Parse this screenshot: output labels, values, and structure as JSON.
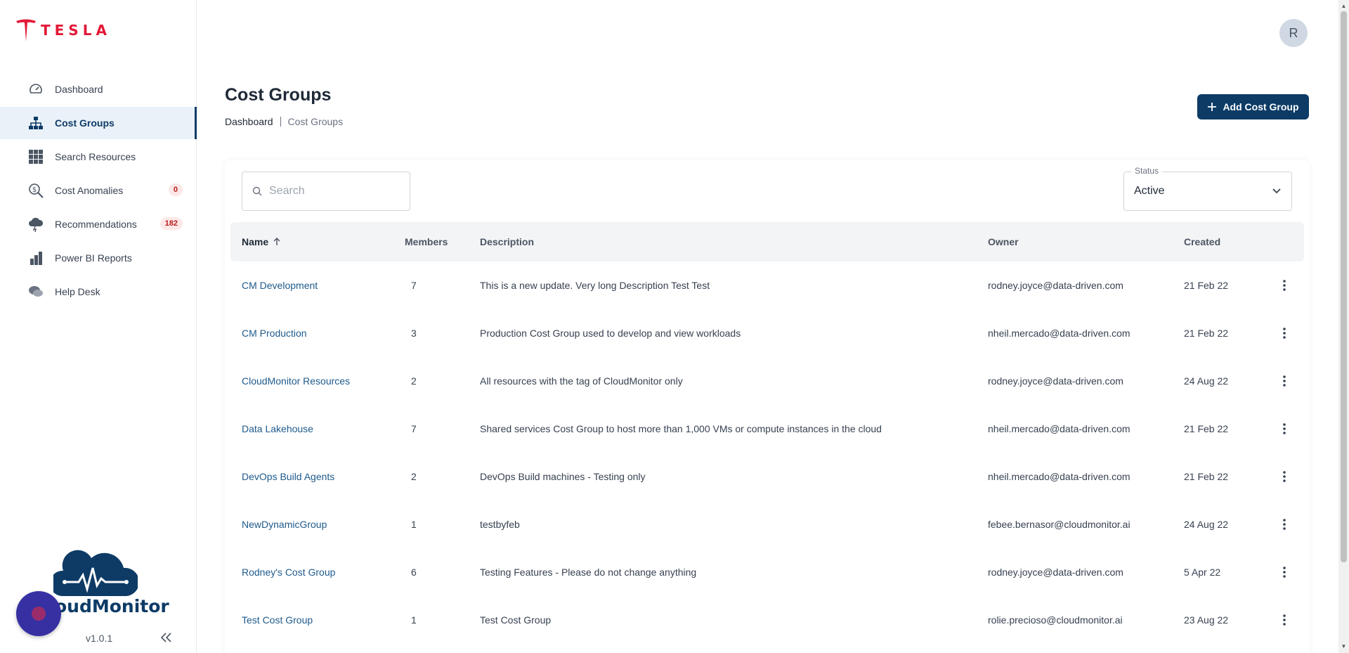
{
  "brand": {
    "logo_text": "TESLA",
    "accent": "#e31937",
    "primary": "#0d3b66"
  },
  "sidebar": {
    "items": [
      {
        "label": "Dashboard",
        "icon": "gauge-icon",
        "active": false
      },
      {
        "label": "Cost Groups",
        "icon": "org-chart-icon",
        "active": true
      },
      {
        "label": "Search Resources",
        "icon": "grid-icon",
        "active": false
      },
      {
        "label": "Cost Anomalies",
        "icon": "dollar-search-icon",
        "active": false,
        "badge": "0"
      },
      {
        "label": "Recommendations",
        "icon": "cloud-lightning-icon",
        "active": false,
        "badge": "182"
      },
      {
        "label": "Power BI Reports",
        "icon": "bar-chart-icon",
        "active": false
      },
      {
        "label": "Help Desk",
        "icon": "chat-icon",
        "active": false
      }
    ],
    "product_name": "oudMonitor",
    "version": "v1.0.1"
  },
  "user": {
    "avatar_initial": "R"
  },
  "header": {
    "title": "Cost Groups",
    "breadcrumb": {
      "home": "Dashboard",
      "current": "Cost Groups"
    },
    "add_button_label": "Add Cost Group"
  },
  "filters": {
    "search_placeholder": "Search",
    "status_label": "Status",
    "status_value": "Active"
  },
  "table": {
    "columns": {
      "name": "Name",
      "members": "Members",
      "description": "Description",
      "owner": "Owner",
      "created": "Created"
    },
    "rows": [
      {
        "name": "CM Development",
        "members": "7",
        "description": "This is a new update. Very long Description Test Test",
        "owner": "rodney.joyce@data-driven.com",
        "created": "21 Feb 22"
      },
      {
        "name": "CM Production",
        "members": "3",
        "description": "Production Cost Group used to develop and view workloads",
        "owner": "nheil.mercado@data-driven.com",
        "created": "21 Feb 22"
      },
      {
        "name": "CloudMonitor Resources",
        "members": "2",
        "description": "All resources with the tag of CloudMonitor only",
        "owner": "rodney.joyce@data-driven.com",
        "created": "24 Aug 22"
      },
      {
        "name": "Data Lakehouse",
        "members": "7",
        "description": "Shared services Cost Group to host more than 1,000 VMs or compute instances in the cloud",
        "owner": "nheil.mercado@data-driven.com",
        "created": "21 Feb 22"
      },
      {
        "name": "DevOps Build Agents",
        "members": "2",
        "description": "DevOps Build machines - Testing only",
        "owner": "nheil.mercado@data-driven.com",
        "created": "21 Feb 22"
      },
      {
        "name": "NewDynamicGroup",
        "members": "1",
        "description": "testbyfeb",
        "owner": "febee.bernasor@cloudmonitor.ai",
        "created": "24 Aug 22"
      },
      {
        "name": "Rodney's Cost Group",
        "members": "6",
        "description": "Testing Features - Please do not change anything",
        "owner": "rodney.joyce@data-driven.com",
        "created": "5 Apr 22"
      },
      {
        "name": "Test Cost Group",
        "members": "1",
        "description": "Test Cost Group",
        "owner": "rolie.precioso@cloudmonitor.ai",
        "created": "23 Aug 22"
      }
    ]
  }
}
